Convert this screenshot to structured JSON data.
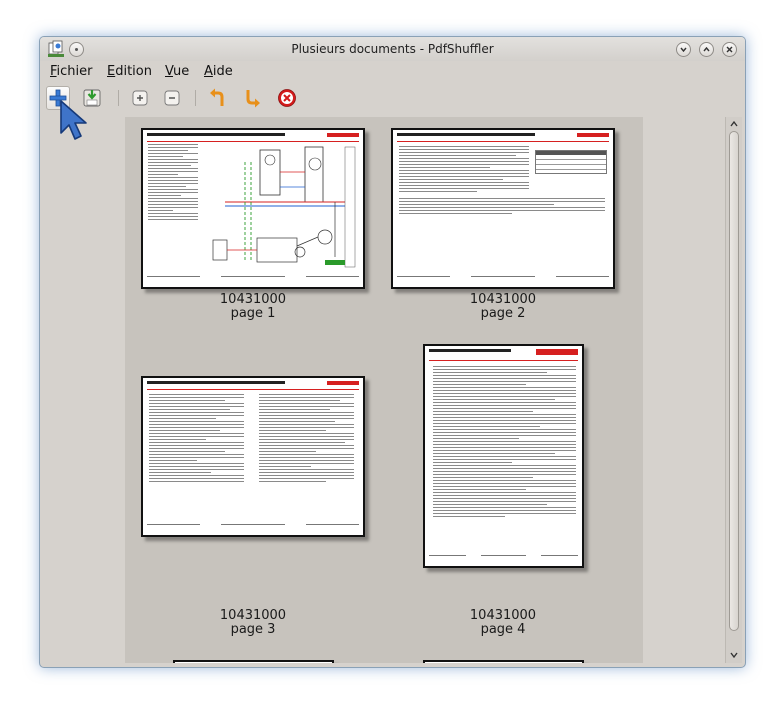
{
  "window": {
    "title": "Plusieurs documents - PdfShuffler"
  },
  "menu": [
    {
      "mnemonic": "F",
      "rest": "ichier"
    },
    {
      "mnemonic": "E",
      "rest": "dition"
    },
    {
      "mnemonic": "V",
      "rest": "ue"
    },
    {
      "mnemonic": "A",
      "rest": "ide"
    }
  ],
  "toolbar": {
    "icons": [
      "add-document-icon",
      "export-icon",
      "zoom-in-icon",
      "zoom-out-icon",
      "rotate-left-icon",
      "rotate-right-icon",
      "delete-icon"
    ]
  },
  "pages": [
    {
      "doc": "10431000",
      "label": "page 1"
    },
    {
      "doc": "10431000",
      "label": "page 2"
    },
    {
      "doc": "10431000",
      "label": "page 3"
    },
    {
      "doc": "10431000",
      "label": "page 4"
    }
  ],
  "colors": {
    "accent": "#d62020",
    "canvas": "#c7c3bd"
  }
}
